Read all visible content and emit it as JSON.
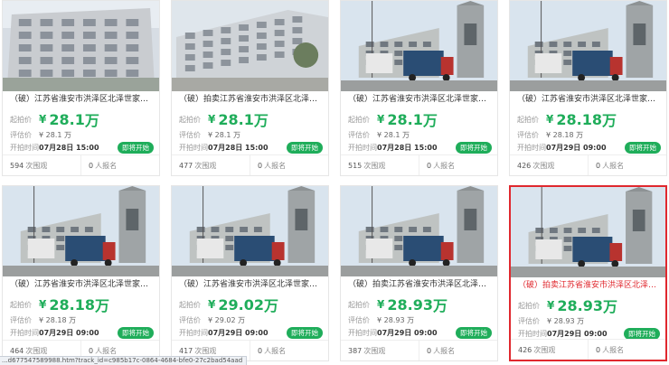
{
  "labels": {
    "start_price": "起拍价",
    "eval_price": "评估价",
    "start_time": "开拍时间",
    "views_suffix": "次围观",
    "signups_suffix": "人报名",
    "yen": "¥",
    "wan": "万"
  },
  "accent": "#1fad5a",
  "active_border": "#e0282e",
  "listings": [
    {
      "title": "（破）江苏省淮安市洪泽区北泽世家小区...",
      "price": "28.1",
      "eval": "¥ 28.1 万",
      "time": "07月28日 15:00",
      "badge": "即将开始",
      "views": "594",
      "signups": "0",
      "photo": "building-facade",
      "active": false
    },
    {
      "title": "（破）拍卖江苏省淮安市洪泽区北泽世...",
      "price": "28.1",
      "eval": "¥ 28.1 万",
      "time": "07月28日 15:00",
      "badge": "即将开始",
      "views": "477",
      "signups": "0",
      "photo": "building-angle",
      "active": false
    },
    {
      "title": "（破）江苏省淮安市洪泽区北泽世家小...",
      "price": "28.1",
      "eval": "¥ 28.1 万",
      "time": "07月28日 15:00",
      "badge": "即将开始",
      "views": "515",
      "signups": "0",
      "photo": "truck-street",
      "active": false
    },
    {
      "title": "（破）江苏省淮安市洪泽区北泽世家小...",
      "price": "28.18",
      "eval": "¥ 28.18 万",
      "time": "07月29日 09:00",
      "badge": "即将开始",
      "views": "426",
      "signups": "0",
      "photo": "truck-street",
      "active": false
    },
    {
      "title": "（破）江苏省淮安市洪泽区北泽世家小...",
      "price": "28.18",
      "eval": "¥ 28.18 万",
      "time": "07月29日 09:00",
      "badge": "即将开始",
      "views": "464",
      "signups": "0",
      "photo": "truck-street",
      "active": false
    },
    {
      "title": "（破）江苏省淮安市洪泽区北泽世家小...",
      "price": "29.02",
      "eval": "¥ 29.02 万",
      "time": "07月29日 09:00",
      "badge": "即将开始",
      "views": "417",
      "signups": "0",
      "photo": "truck-street",
      "active": false
    },
    {
      "title": "（破）拍卖江苏省淮安市洪泽区北泽世...",
      "price": "28.93",
      "eval": "¥ 28.93 万",
      "time": "07月29日 09:00",
      "badge": "即将开始",
      "views": "387",
      "signups": "0",
      "photo": "truck-street",
      "active": false
    },
    {
      "title": "（破）拍卖江苏省淮安市洪泽区北泽世...",
      "price": "28.93",
      "eval": "¥ 28.93 万",
      "time": "07月29日 09:00",
      "badge": "即将开始",
      "views": "426",
      "signups": "0",
      "photo": "truck-street",
      "active": true
    }
  ],
  "status_bar": {
    "url": "...d677547589988.htm?track_id=c985b17c-0864-4684-bfe0-27c2bad54aad"
  }
}
